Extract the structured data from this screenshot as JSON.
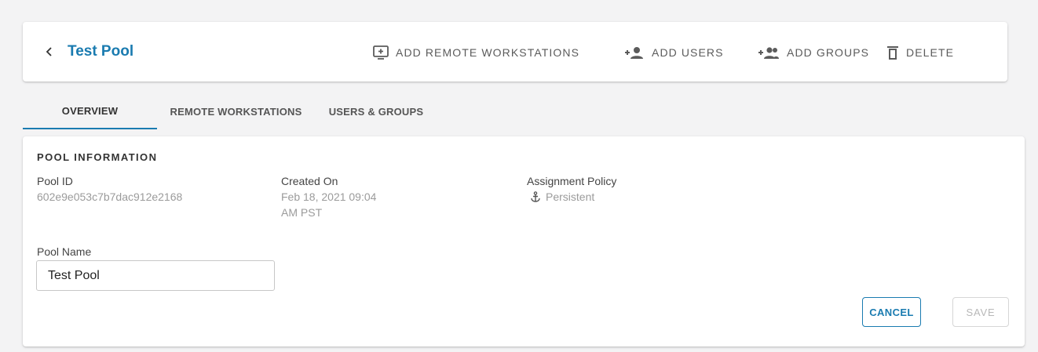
{
  "header": {
    "title": "Test Pool",
    "actions": [
      {
        "label": "ADD REMOTE WORKSTATIONS",
        "icon": "add-to-screen-icon"
      },
      {
        "label": "ADD USERS",
        "icon": "add-user-icon"
      },
      {
        "label": "ADD GROUPS",
        "icon": "add-group-icon"
      },
      {
        "label": "DELETE",
        "icon": "trash-icon"
      }
    ]
  },
  "tabs": [
    {
      "label": "OVERVIEW",
      "active": true
    },
    {
      "label": "REMOTE WORKSTATIONS",
      "active": false
    },
    {
      "label": "USERS & GROUPS",
      "active": false
    }
  ],
  "pool_info": {
    "section_title": "POOL INFORMATION",
    "pool_id_label": "Pool ID",
    "pool_id_value": "602e9e053c7b7dac912e2168",
    "created_label": "Created On",
    "created_value_line1": "Feb 18, 2021 09:04",
    "created_value_line2": "AM PST",
    "policy_label": "Assignment Policy",
    "policy_value": "Persistent",
    "policy_icon": "anchor-icon",
    "pool_name_label": "Pool Name",
    "pool_name_value": "Test Pool"
  },
  "form_actions": {
    "cancel_label": "CANCEL",
    "save_label": "SAVE",
    "save_enabled": false
  },
  "colors": {
    "accent": "#1a7bb0",
    "background": "#f3f3f4",
    "muted_text": "#9b9b9b"
  }
}
